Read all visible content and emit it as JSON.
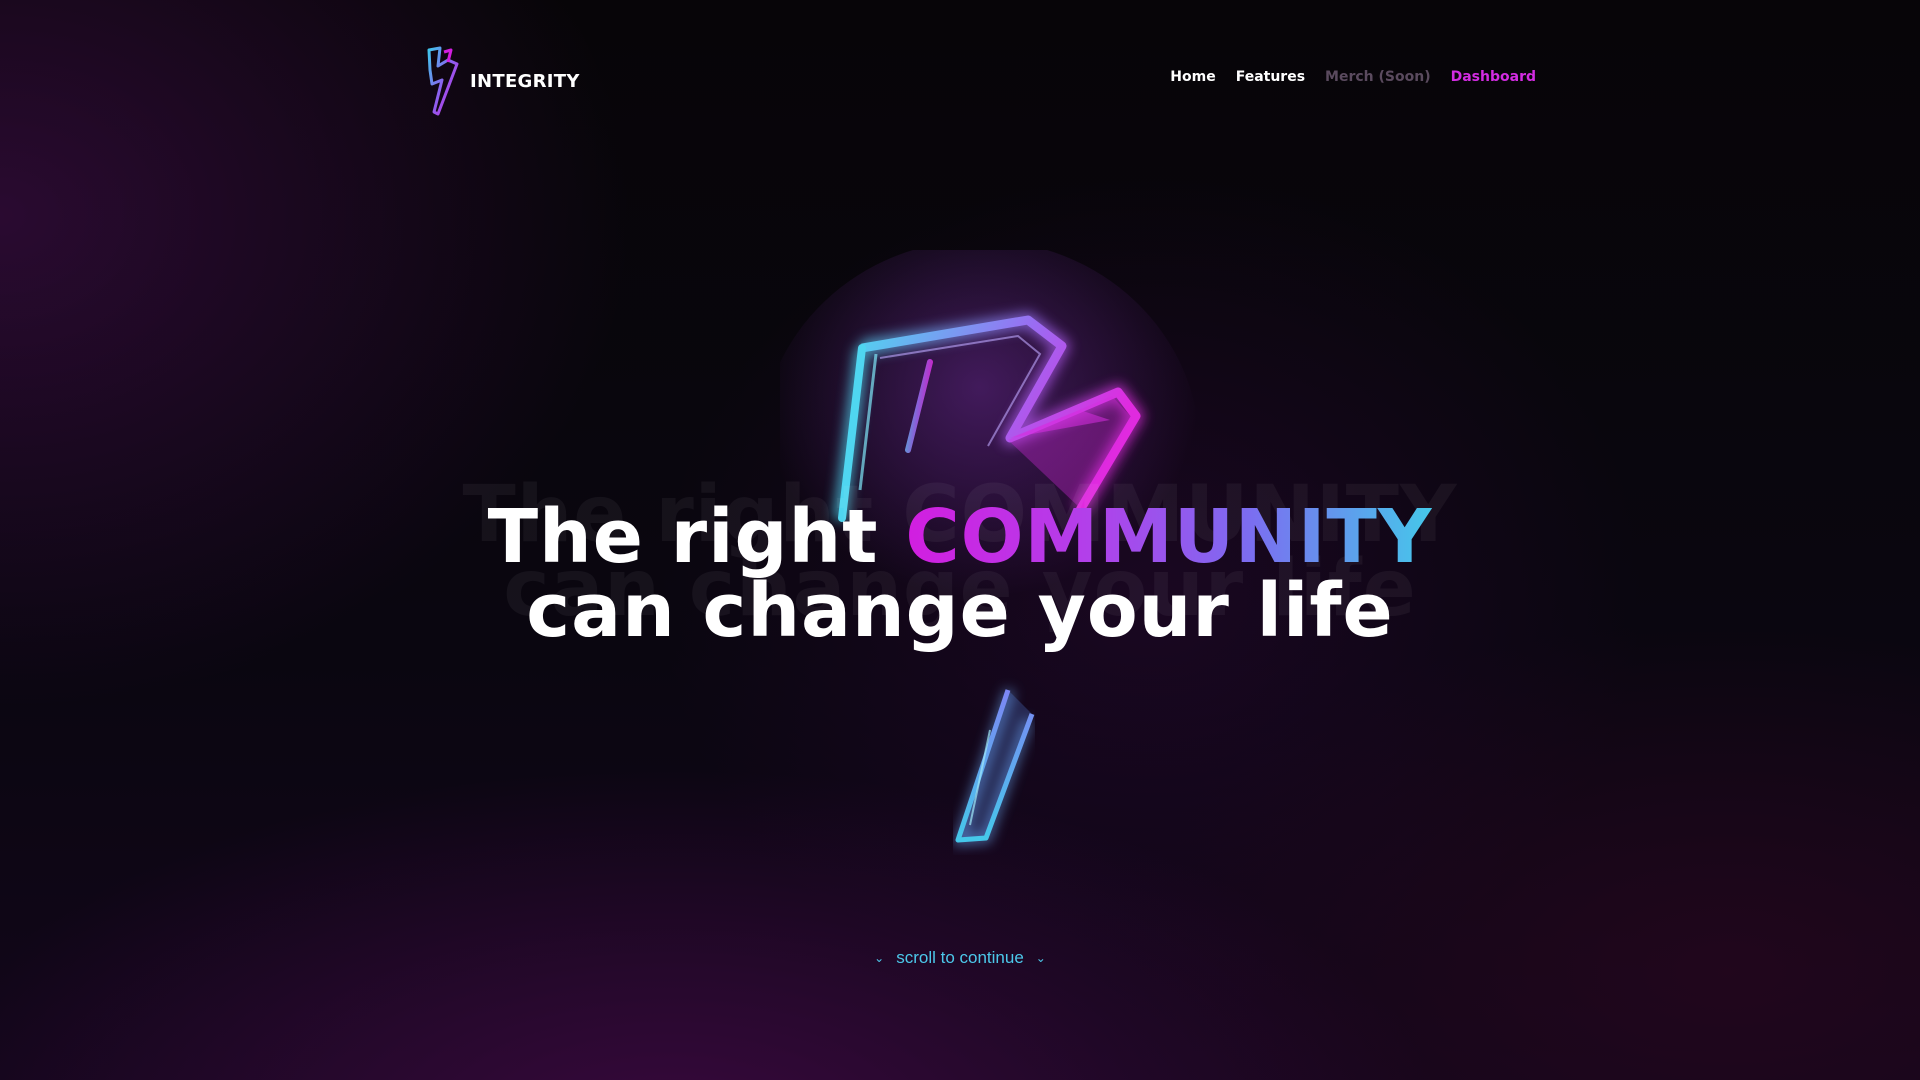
{
  "brand": {
    "name": "INTEGRITY",
    "logo_icon": "lightning-bolt-icon"
  },
  "nav": {
    "home": "Home",
    "features": "Features",
    "merch": "Merch (Soon)",
    "dashboard": "Dashboard"
  },
  "hero": {
    "line1_prefix": "The right ",
    "line1_highlight": "COMMUNITY",
    "line2": "can change your life",
    "art_icon": "neon-lightning-bolt"
  },
  "scroll_cue": {
    "label": "scroll to continue",
    "icon": "chevron-double-down-icon"
  },
  "colors": {
    "accent_magenta": "#d32ce2",
    "accent_cyan": "#4cc8ea",
    "muted": "#5a4a5e",
    "background": "#050307"
  }
}
